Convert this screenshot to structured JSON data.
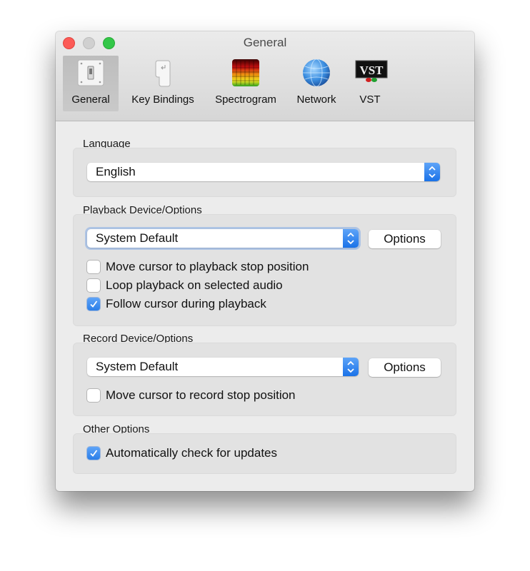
{
  "window": {
    "title": "General"
  },
  "toolbar": {
    "items": [
      {
        "label": "General",
        "icon": "toggle-switch-icon",
        "selected": true
      },
      {
        "label": "Key Bindings",
        "icon": "keyboard-key-icon",
        "selected": false
      },
      {
        "label": "Spectrogram",
        "icon": "spectrogram-icon",
        "selected": false
      },
      {
        "label": "Network",
        "icon": "globe-icon",
        "selected": false
      },
      {
        "label": "VST",
        "icon": "vst-logo-icon",
        "selected": false
      }
    ]
  },
  "language": {
    "group_label": "Language",
    "selected": "English"
  },
  "playback": {
    "group_label": "Playback Device/Options",
    "device": "System Default",
    "options_label": "Options",
    "checkboxes": [
      {
        "label": "Move cursor to playback stop position",
        "checked": false
      },
      {
        "label": "Loop playback on selected audio",
        "checked": false
      },
      {
        "label": "Follow cursor during playback",
        "checked": true
      }
    ]
  },
  "record": {
    "group_label": "Record Device/Options",
    "device": "System Default",
    "options_label": "Options",
    "checkboxes": [
      {
        "label": "Move cursor to record stop position",
        "checked": false
      }
    ]
  },
  "other": {
    "group_label": "Other Options",
    "checkboxes": [
      {
        "label": "Automatically check for updates",
        "checked": true
      }
    ]
  },
  "colors": {
    "accent": "#2b7ee8",
    "close": "#fc5b57",
    "minimize": "#d0d0d0",
    "zoom": "#33c748"
  }
}
